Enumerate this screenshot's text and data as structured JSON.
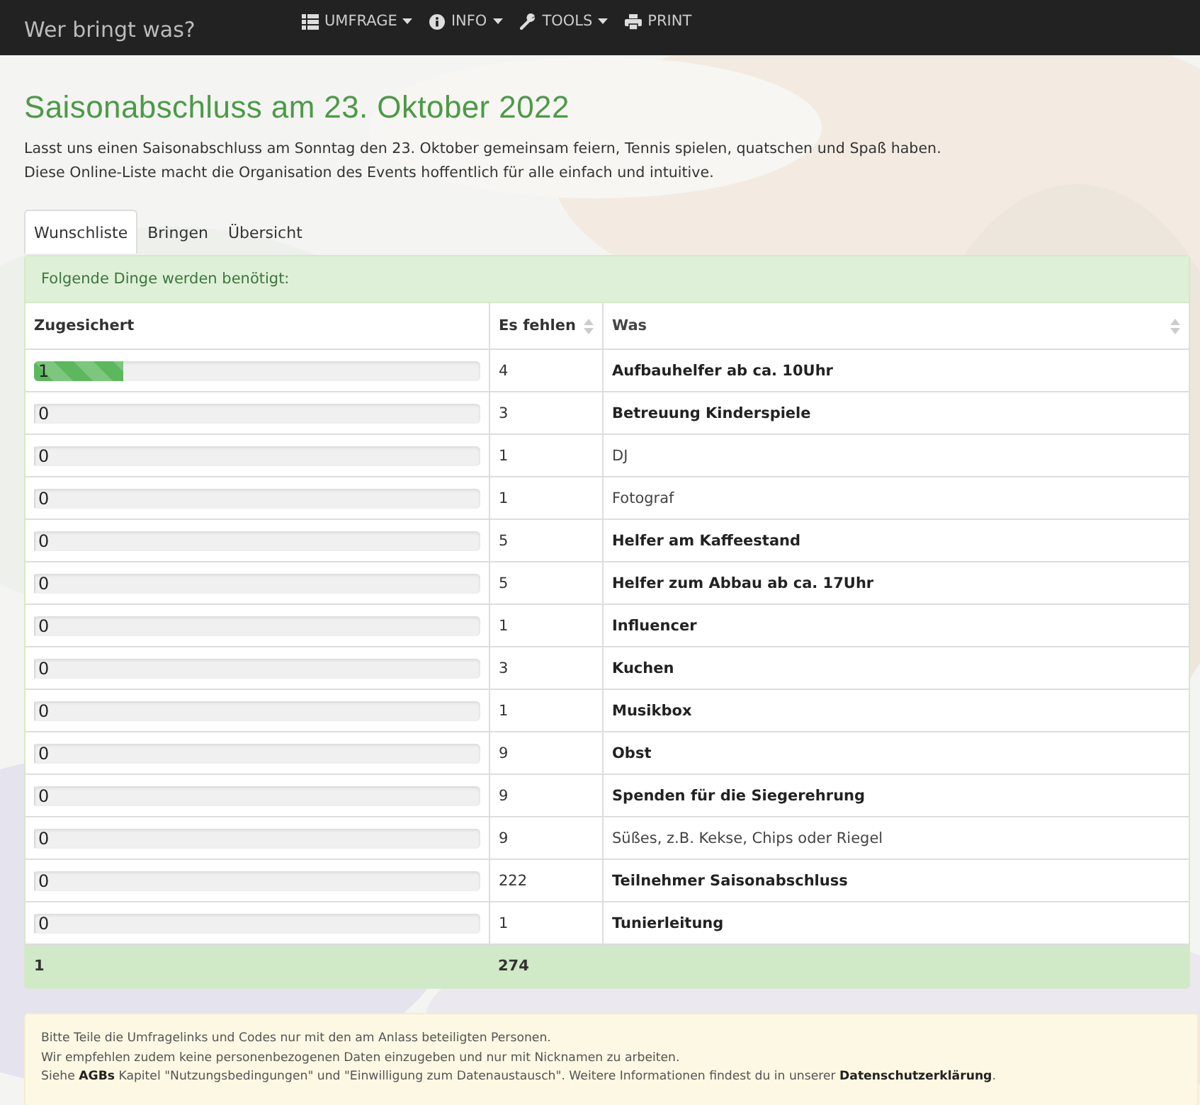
{
  "navbar": {
    "brand": "Wer bringt was?",
    "menu": [
      {
        "label": "UMFRAGE",
        "dropdown": true
      },
      {
        "label": "INFO",
        "dropdown": true
      },
      {
        "label": "TOOLS",
        "dropdown": true
      },
      {
        "label": "PRINT",
        "dropdown": false
      }
    ]
  },
  "title": "Saisonabschluss am 23. Oktober 2022",
  "intro": [
    "Lasst uns einen Saisonabschluss am Sonntag den 23. Oktober gemeinsam feiern, Tennis spielen, quatschen und Spaß haben.",
    "Diese Online-Liste macht die Organisation des Events hoffentlich für alle einfach und intuitive."
  ],
  "tabs": [
    {
      "label": "Wunschliste",
      "selected": true
    },
    {
      "label": "Bringen",
      "selected": false
    },
    {
      "label": "Übersicht",
      "selected": false
    }
  ],
  "panel_heading": "Folgende Dinge werden benötigt:",
  "table": {
    "columns": [
      {
        "label": "Zugesichert",
        "sortable": false
      },
      {
        "label": "Es fehlen",
        "sortable": true
      },
      {
        "label": "Was",
        "sortable": true
      }
    ],
    "rows": [
      {
        "assured": "1",
        "level": 0.2,
        "missing": "4",
        "what": "Aufbauhelfer ab ca. 10Uhr",
        "bold": true
      },
      {
        "assured": "0",
        "level": 0,
        "missing": "3",
        "what": "Betreuung Kinderspiele",
        "bold": true
      },
      {
        "assured": "0",
        "level": 0,
        "missing": "1",
        "what": "DJ",
        "bold": false
      },
      {
        "assured": "0",
        "level": 0,
        "missing": "1",
        "what": "Fotograf",
        "bold": false
      },
      {
        "assured": "0",
        "level": 0,
        "missing": "5",
        "what": "Helfer am Kaffeestand",
        "bold": true
      },
      {
        "assured": "0",
        "level": 0,
        "missing": "5",
        "what": "Helfer zum Abbau ab ca. 17Uhr",
        "bold": true
      },
      {
        "assured": "0",
        "level": 0,
        "missing": "1",
        "what": "Influencer",
        "bold": true
      },
      {
        "assured": "0",
        "level": 0,
        "missing": "3",
        "what": "Kuchen",
        "bold": true
      },
      {
        "assured": "0",
        "level": 0,
        "missing": "1",
        "what": "Musikbox",
        "bold": true
      },
      {
        "assured": "0",
        "level": 0,
        "missing": "9",
        "what": "Obst",
        "bold": true
      },
      {
        "assured": "0",
        "level": 0,
        "missing": "9",
        "what": "Spenden für die Siegerehrung",
        "bold": true
      },
      {
        "assured": "0",
        "level": 0,
        "missing": "9",
        "what": "Süßes, z.B. Kekse, Chips oder Riegel",
        "bold": false
      },
      {
        "assured": "0",
        "level": 0,
        "missing": "222",
        "what": "Teilnehmer Saisonabschluss",
        "bold": true
      },
      {
        "assured": "0",
        "level": 0,
        "missing": "1",
        "what": "Tunierleitung",
        "bold": true
      }
    ],
    "totals": {
      "assured": "1",
      "missing": "274"
    }
  },
  "notice": [
    "Bitte Teile die Umfragelinks und Codes nur mit den am Anlass beteiligten Personen.",
    "Wir empfehlen zudem keine personenbezogenen Daten einzugeben und nur mit Nicknamen zu arbeiten."
  ],
  "notice_links": {
    "before": "Siehe",
    "agb": "AGBs",
    "middle": "Kapitel \"Nutzungsbedingungen\" und \"Einwilligung zum Datenaustausch\". Weitere Informationen findest du in unserer",
    "privacy": "Datenschutzerklärung",
    "after": "."
  }
}
